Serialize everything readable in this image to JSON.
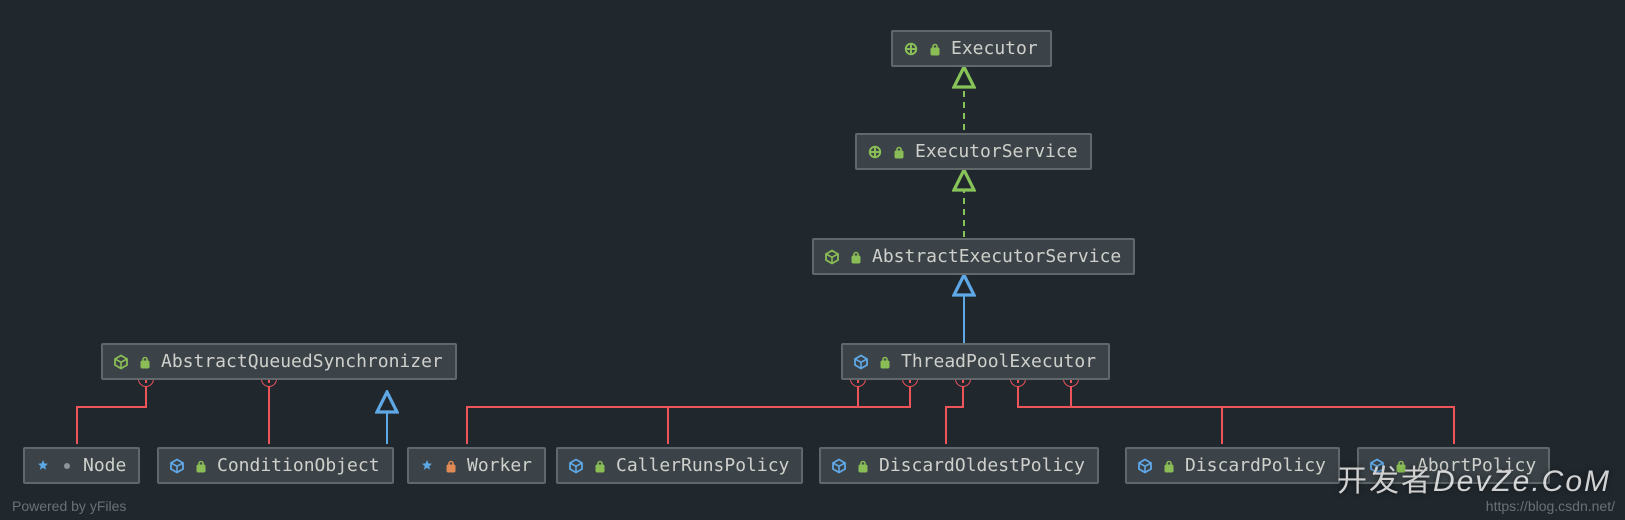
{
  "nodes": {
    "executor": {
      "label": "Executor",
      "kind": "interface",
      "access": "public"
    },
    "executorService": {
      "label": "ExecutorService",
      "kind": "interface",
      "access": "public"
    },
    "abstractExecSvc": {
      "label": "AbstractExecutorService",
      "kind": "abstract",
      "access": "public"
    },
    "threadPoolExec": {
      "label": "ThreadPoolExecutor",
      "kind": "class",
      "access": "public"
    },
    "aqs": {
      "label": "AbstractQueuedSynchronizer",
      "kind": "abstract",
      "access": "public"
    },
    "nodeCls": {
      "label": "Node",
      "kind": "class",
      "access": "package"
    },
    "condObj": {
      "label": "ConditionObject",
      "kind": "class",
      "access": "public"
    },
    "worker": {
      "label": "Worker",
      "kind": "class",
      "access": "private"
    },
    "callerRuns": {
      "label": "CallerRunsPolicy",
      "kind": "class",
      "access": "public"
    },
    "discardOldest": {
      "label": "DiscardOldestPolicy",
      "kind": "class",
      "access": "public"
    },
    "discard": {
      "label": "DiscardPolicy",
      "kind": "class",
      "access": "public"
    },
    "abort": {
      "label": "AbortPolicy",
      "kind": "class",
      "access": "public"
    }
  },
  "footer": {
    "left": "Powered by yFiles",
    "right": "https://blog.csdn.net/"
  },
  "watermark": "DevZe.CoM",
  "watermarkLeft": "开发者",
  "colors": {
    "realization": "#88c359",
    "generalization": "#5fa8e6",
    "inner": "#ee545a"
  }
}
